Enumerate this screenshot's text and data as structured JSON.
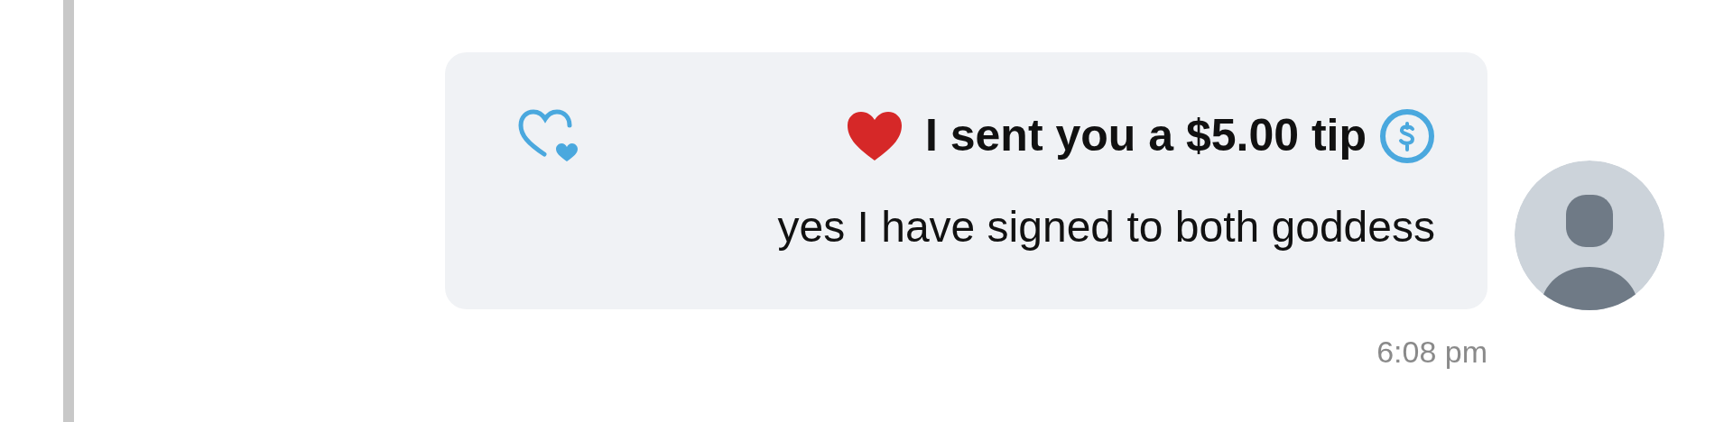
{
  "message": {
    "tip_text": "I sent you a $5.00 tip",
    "body": "yes I have signed to both goddess",
    "time": "6:08 pm",
    "liked": false
  }
}
